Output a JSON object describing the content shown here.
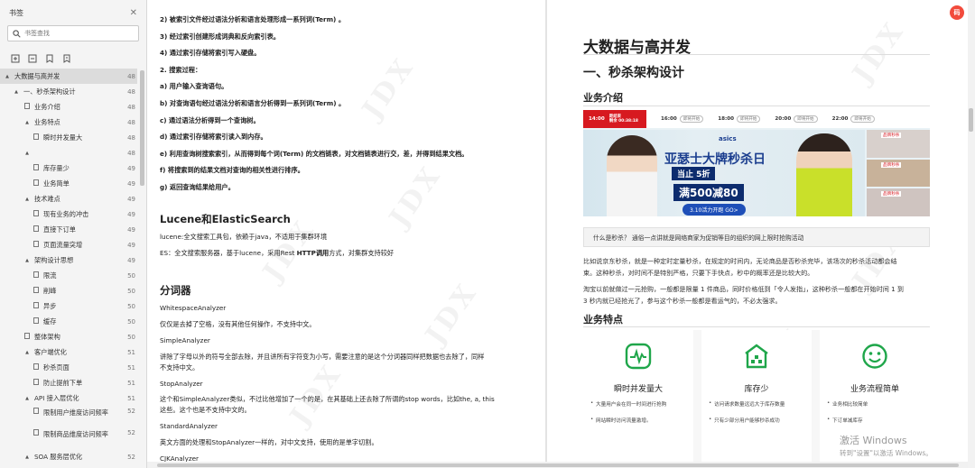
{
  "sidebar": {
    "title": "书签",
    "search_placeholder": "书签查找",
    "items": [
      {
        "label": "大数据与高并发",
        "page": "48",
        "level": 0,
        "twisty": "▲",
        "selected": true
      },
      {
        "label": "一、秒杀架构设计",
        "page": "48",
        "level": 1,
        "twisty": "▲"
      },
      {
        "label": "业务介绍",
        "page": "48",
        "level": 2,
        "twisty": ""
      },
      {
        "label": "业务特点",
        "page": "48",
        "level": 2,
        "twisty": "▲"
      },
      {
        "label": "瞬时并发量大",
        "page": "48",
        "level": 3,
        "twisty": ""
      },
      {
        "label": "",
        "page": "48",
        "level": 2,
        "twisty": "▲"
      },
      {
        "label": "库存量少",
        "page": "49",
        "level": 3,
        "twisty": ""
      },
      {
        "label": "业务简单",
        "page": "49",
        "level": 3,
        "twisty": ""
      },
      {
        "label": "技术难点",
        "page": "49",
        "level": 2,
        "twisty": "▲"
      },
      {
        "label": "现有业务的冲击",
        "page": "49",
        "level": 3,
        "twisty": ""
      },
      {
        "label": "直接下订单",
        "page": "49",
        "level": 3,
        "twisty": ""
      },
      {
        "label": "页面流量突增",
        "page": "49",
        "level": 3,
        "twisty": ""
      },
      {
        "label": "架构设计思想",
        "page": "49",
        "level": 2,
        "twisty": "▲"
      },
      {
        "label": "限流",
        "page": "50",
        "level": 3,
        "twisty": ""
      },
      {
        "label": "削峰",
        "page": "50",
        "level": 3,
        "twisty": ""
      },
      {
        "label": "异步",
        "page": "50",
        "level": 3,
        "twisty": ""
      },
      {
        "label": "缓存",
        "page": "50",
        "level": 3,
        "twisty": ""
      },
      {
        "label": "整体架构",
        "page": "50",
        "level": 2,
        "twisty": ""
      },
      {
        "label": "客户端优化",
        "page": "51",
        "level": 2,
        "twisty": "▲"
      },
      {
        "label": "秒杀页面",
        "page": "51",
        "level": 3,
        "twisty": ""
      },
      {
        "label": "防止提前下单",
        "page": "51",
        "level": 3,
        "twisty": ""
      },
      {
        "label": "API 接入层优化",
        "page": "51",
        "level": 2,
        "twisty": "▲"
      },
      {
        "label": "限制用户维度访问频率",
        "page": "52",
        "level": 3,
        "twisty": "",
        "tall": true
      },
      {
        "label": "限制商品维度访问频率",
        "page": "52",
        "level": 3,
        "twisty": "",
        "tall": true
      },
      {
        "label": "SOA 服务层优化",
        "page": "52",
        "level": 2,
        "twisty": "▲"
      }
    ]
  },
  "left_page": {
    "lines": [
      {
        "text": "2) 被索引文件经过语法分析和语言处理形成一系列词(Term) 。",
        "bold": true
      },
      {
        "text": "3) 经过索引创建形成词典和反向索引表。",
        "bold": true
      },
      {
        "text": "4) 通过索引存储将索引写入硬盘。",
        "bold": true
      },
      {
        "text": "2. 搜索过程：",
        "bold": true
      },
      {
        "text": "a) 用户输入查询语句。",
        "bold": true
      },
      {
        "text": "b) 对查询语句经过语法分析和语言分析得到一系列词(Term) 。",
        "bold": true
      },
      {
        "text": "c) 通过语法分析得到一个查询树。",
        "bold": true
      },
      {
        "text": "d) 通过索引存储将索引读入到内存。",
        "bold": true
      },
      {
        "text": "e) 利用查询树搜索索引，从而得到每个词(Term) 的文档链表，对文档链表进行交，差，并得到结果文档。",
        "bold": true
      },
      {
        "text": "f) 将搜索到的结果文档对查询的相关性进行排序。",
        "bold": true
      },
      {
        "text": "g) 返回查询结果给用户。",
        "bold": true
      }
    ],
    "h_lucene": "Lucene和ElasticSearch",
    "lucene_line": "lucene:全文搜索工具包，依赖于java，不适用于集群环境",
    "es_line_a": "ES：全文搜索服务器，基于lucene，采用Rest ",
    "es_line_b": "HTTP调用",
    "es_line_c": "方式，对集群支持较好",
    "h_analyzer": "分词器",
    "ws_name": "WhitespaceAnalyzer",
    "ws_desc": "仅仅是去掉了空格，没有其他任何操作，不支持中文。",
    "simple_name": "SimpleAnalyzer",
    "simple_desc_1": "讲除了字母以外的符号全部去除，并且讲所有字符变为小写，需要注意的是这个分词器同样把数据也去除了，同样",
    "simple_desc_2": "不支持中文。",
    "stop_name": "StopAnalyzer",
    "stop_desc_1": "这个和SimpleAnalyzer类似，不过比他增加了一个的是，在其基础上还去除了所谓的stop words，比如the, a, this",
    "stop_desc_2": "这些。这个也是不支持中文的。",
    "std_name": "StandardAnalyzer",
    "std_desc": "英文方面的处理和StopAnalyzer一样的，对中文支持，使用的是单字切割。",
    "cjk_name": "CJKAnalyzer"
  },
  "right_page": {
    "h1": "大数据与高并发",
    "h1b": "一、秒杀架构设计",
    "h_intro": "业务介绍",
    "banner": {
      "now_time": "14:00",
      "now_sub_1": "距结束",
      "now_sub_2": "剩余 00:38:18",
      "slots": [
        {
          "time": "16:00",
          "label": "即将开始"
        },
        {
          "time": "18:00",
          "label": "即将开始"
        },
        {
          "time": "20:00",
          "label": "即将开始"
        },
        {
          "time": "22:00",
          "label": "即将开始"
        }
      ],
      "brand": "asics",
      "headline": "亚瑟士大牌秒杀日",
      "badge1": "当止 5折",
      "badge2": "满500减80",
      "cta": "3.10活力开跑 GO>",
      "side_tag": "品牌秒杀"
    },
    "callout": "什么是秒杀？ 通俗一点讲就是网络商家为促销等目的组织的网上限时抢购活动",
    "para1_a": "比如说京东秒杀，就是一种定时定量秒杀，在规定的时间内，无论商品是否秒杀完毕，该场次的秒杀活动都会结",
    "para1_b": "束。这种秒杀，对时间不是特别严格，只要下手快点，秒中的概率还是比较大的。",
    "para2_a": "淘宝以前就做过一元抢购，一般都是限量 1 件商品，同时价格低到「令人发指」，这种秒杀一般都在开始时间 1 到",
    "para2_b": "3 秒内就已经抢光了，参与这个秒杀一般都是看运气的，不必太强求。",
    "h_features": "业务特点",
    "cards": [
      {
        "title": "瞬时并发量大",
        "b1": "大量用户会在同一时间进行抢购",
        "b2": "网站瞬时访问流量激增。",
        "icon": "pulse-icon"
      },
      {
        "title": "库存少",
        "b1": "访问请求数量远远大于库存数量",
        "b2": "只有少部分用户能够秒杀成功",
        "icon": "warehouse-icon"
      },
      {
        "title": "业务流程简单",
        "b1": "业务相比较简单",
        "b2": "下订单减库存",
        "icon": "smile-icon"
      }
    ],
    "colors": {
      "accent": "#1fa64a",
      "brand_red": "#d71920",
      "navy": "#0d2c6e"
    }
  },
  "windows_activation": {
    "line1": "激活 Windows",
    "line2": "转到\"设置\"以激活 Windows。"
  },
  "fab_label": "码"
}
